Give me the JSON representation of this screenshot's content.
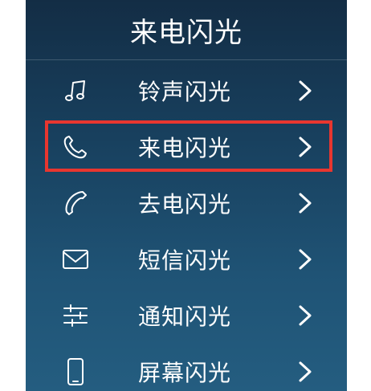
{
  "header": {
    "title": "来电闪光"
  },
  "menu": {
    "items": [
      {
        "label": "铃声闪光",
        "icon": "music-note-icon"
      },
      {
        "label": "来电闪光",
        "icon": "phone-incoming-icon"
      },
      {
        "label": "去电闪光",
        "icon": "phone-outgoing-icon"
      },
      {
        "label": "短信闪光",
        "icon": "envelope-icon"
      },
      {
        "label": "通知闪光",
        "icon": "sliders-icon"
      },
      {
        "label": "屏幕闪光",
        "icon": "smartphone-icon"
      }
    ]
  },
  "colors": {
    "background_top": "#132d45",
    "background_bottom": "#245d80",
    "text": "#ffffff",
    "highlight_border": "#e8362f"
  }
}
